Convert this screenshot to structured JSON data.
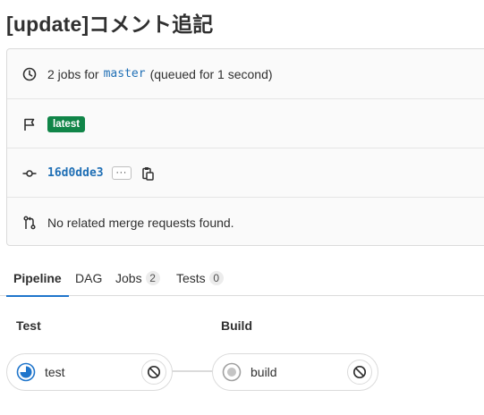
{
  "page": {
    "title": "[update]コメント追記"
  },
  "info": {
    "jobs_prefix": "2 jobs for",
    "branch": "master",
    "jobs_suffix": "(queued for 1 second)",
    "badge_latest": "latest",
    "commit_sha": "16d0dde3",
    "ellipsis": "···",
    "merge_requests": "No related merge requests found."
  },
  "tabs": [
    {
      "label": "Pipeline",
      "active": true
    },
    {
      "label": "DAG"
    },
    {
      "label": "Jobs",
      "count": "2"
    },
    {
      "label": "Tests",
      "count": "0"
    }
  ],
  "stages": [
    {
      "name": "Test",
      "jobs": [
        {
          "name": "test",
          "status": "running"
        }
      ]
    },
    {
      "name": "Build",
      "jobs": [
        {
          "name": "build",
          "status": "created"
        }
      ]
    }
  ],
  "colors": {
    "link": "#1f6fb5",
    "badge_success": "#108548",
    "tab_active_underline": "#1f75cb",
    "running_blue": "#1f75cb"
  },
  "icons": {
    "row1": "clock-icon",
    "row2": "flag-icon",
    "row3": "commit-icon",
    "row4": "merge-request-icon",
    "copy": "copy-to-clipboard-icon",
    "job_action": "cancel-icon",
    "status_running": "status-running-icon",
    "status_created": "status-created-icon"
  }
}
